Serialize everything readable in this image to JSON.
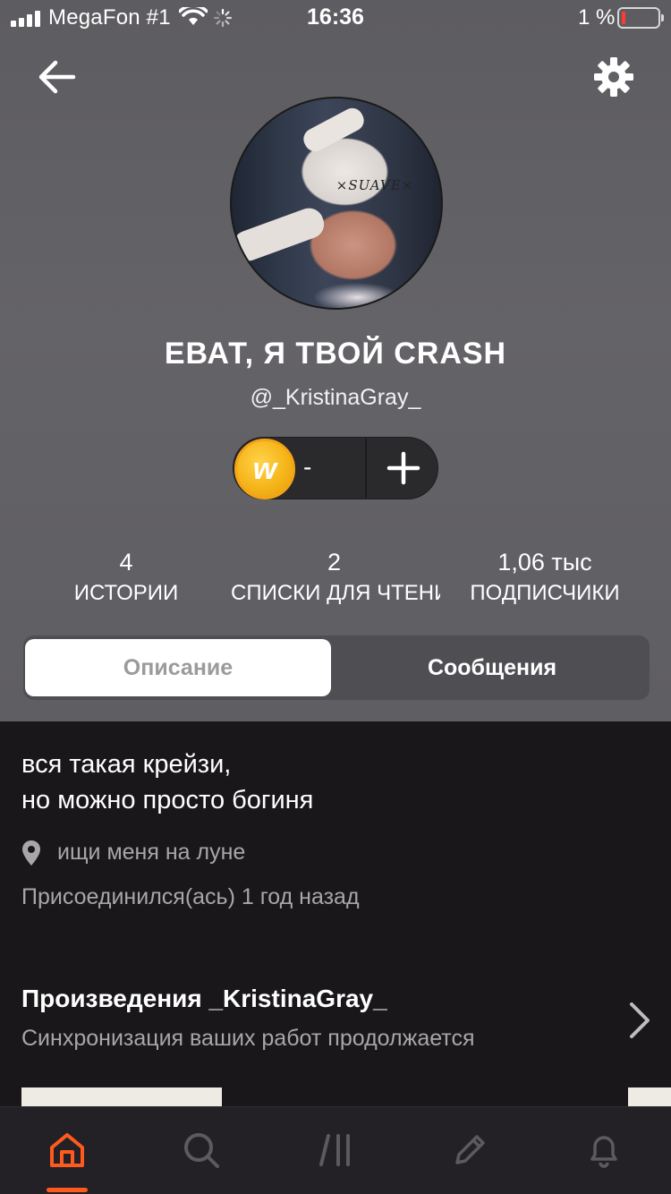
{
  "status_bar": {
    "carrier": "MegaFon #1",
    "time": "16:36",
    "battery_percent": "1 %",
    "battery_level": 0.01
  },
  "header": {
    "back_icon": "arrow-left-icon",
    "settings_icon": "gear-icon"
  },
  "profile": {
    "avatar_shirt_text": "×SUAVE×",
    "display_name": "ЕВАТ, Я ТВОЙ CRASH",
    "username": "@_KristinaGray_"
  },
  "coins": {
    "icon_letter": "w",
    "value": "-",
    "add_label": "+"
  },
  "stats": [
    {
      "value": "4",
      "label": "ИСТОРИИ"
    },
    {
      "value": "2",
      "label": "СПИСКИ ДЛЯ ЧТЕНИЯ"
    },
    {
      "value": "1,06 тыс",
      "label": "ПОДПИСЧИКИ"
    }
  ],
  "tabs_segment": {
    "description": "Описание",
    "messages": "Сообщения",
    "active": "description"
  },
  "about": {
    "bio_line1": "вся такая крейзи,",
    "bio_line2": "но можно просто богиня",
    "location": "ищи меня на луне",
    "joined": "Присоединился(ась) 1 год назад"
  },
  "works": {
    "title": "Произведения _KristinaGray_",
    "subtitle": "Синхронизация ваших работ продолжается"
  },
  "tabbar": {
    "items": [
      "home-icon",
      "search-icon",
      "library-icon",
      "pencil-icon",
      "bell-icon"
    ],
    "active": "home",
    "active_color": "#ff5a1e",
    "inactive_color": "#5b5a5e"
  }
}
